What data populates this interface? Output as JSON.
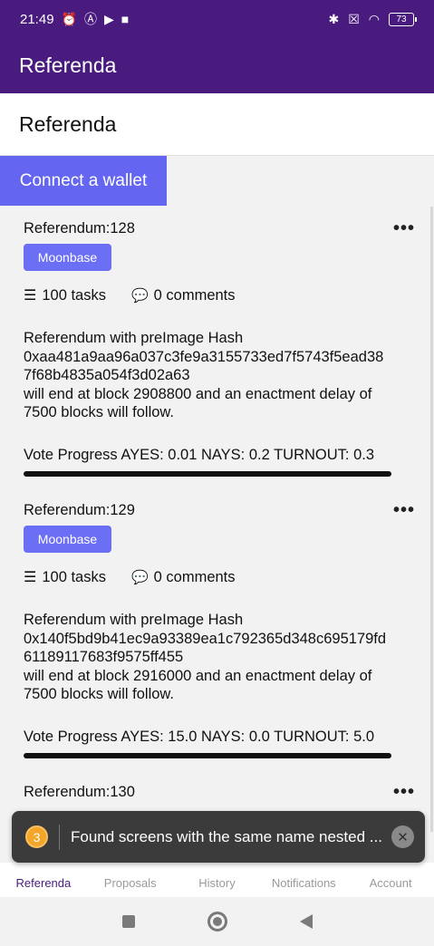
{
  "status_bar": {
    "time": "21:49",
    "left_icons": [
      "alarm-icon",
      "a-icon",
      "camera-icon",
      "video-icon"
    ],
    "right_icons": [
      "bluetooth-icon",
      "sim-icon",
      "wifi-icon"
    ],
    "battery": "73"
  },
  "app_bar": {
    "title": "Referenda"
  },
  "page": {
    "heading": "Referenda"
  },
  "connect_button": {
    "label": "Connect a wallet"
  },
  "referenda": [
    {
      "title": "Referendum:128",
      "chip": "Moonbase",
      "tasks": "100 tasks",
      "comments": "0 comments",
      "description": "Referendum with preImage Hash 0xaa481a9aa96a037c3fe9a3155733ed7f5743f5ead387f68b4835a054f3d02a63 will end at block 2908800 and an enactment delay of 7500 blocks will follow.",
      "description_lines": [
        "Referendum with preImage Hash",
        "0xaa481a9aa96a037c3fe9a3155733ed7f5743f5ead38",
        "7f68b4835a054f3d02a63",
        "will end at block 2908800 and an enactment delay of",
        "7500 blocks will follow."
      ],
      "vote_progress": "Vote Progress AYES: 0.01 NAYS: 0.2 TURNOUT: 0.3"
    },
    {
      "title": "Referendum:129",
      "chip": "Moonbase",
      "tasks": "100 tasks",
      "comments": "0 comments",
      "description_lines": [
        "Referendum with preImage Hash",
        "0x140f5bd9b41ec9a93389ea1c792365d348c695179fd",
        "61189117683f9575ff455",
        "will end at block 2916000 and an enactment delay of",
        "7500 blocks will follow."
      ],
      "vote_progress": "Vote Progress AYES: 15.0 NAYS: 0.0 TURNOUT: 5.0"
    },
    {
      "title": "Referendum:130"
    }
  ],
  "snackbar": {
    "badge": "3",
    "message": "Found screens with the same name nested ..."
  },
  "bottom_nav": [
    {
      "label": "Referenda",
      "active": true
    },
    {
      "label": "Proposals",
      "active": false
    },
    {
      "label": "History",
      "active": false
    },
    {
      "label": "Notifications",
      "active": false
    },
    {
      "label": "Account",
      "active": false
    }
  ],
  "colors": {
    "primary": "#4a1b7e",
    "accent": "#6466f1",
    "chip": "#6b6ff5"
  }
}
